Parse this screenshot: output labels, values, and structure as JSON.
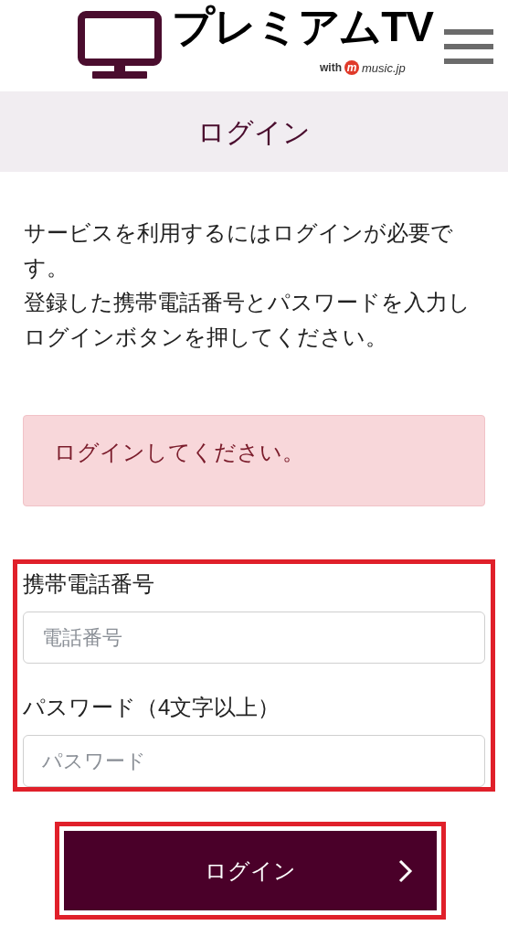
{
  "header": {
    "logo_title": "プレミアムTV",
    "logo_with": "with",
    "logo_badge": "m",
    "logo_partner": "music.jp"
  },
  "page_title": "ログイン",
  "intro": [
    "サービスを利用するにはログインが必要です。",
    "登録した携帯電話番号とパスワードを入力しログインボタンを押してください。"
  ],
  "alert": "ログインしてください。",
  "form": {
    "fields": [
      {
        "label": "携帯電話番号",
        "placeholder": "電話番号"
      },
      {
        "label": "パスワード（4文字以上）",
        "placeholder": "パスワード"
      }
    ]
  },
  "login_button": "ログイン"
}
